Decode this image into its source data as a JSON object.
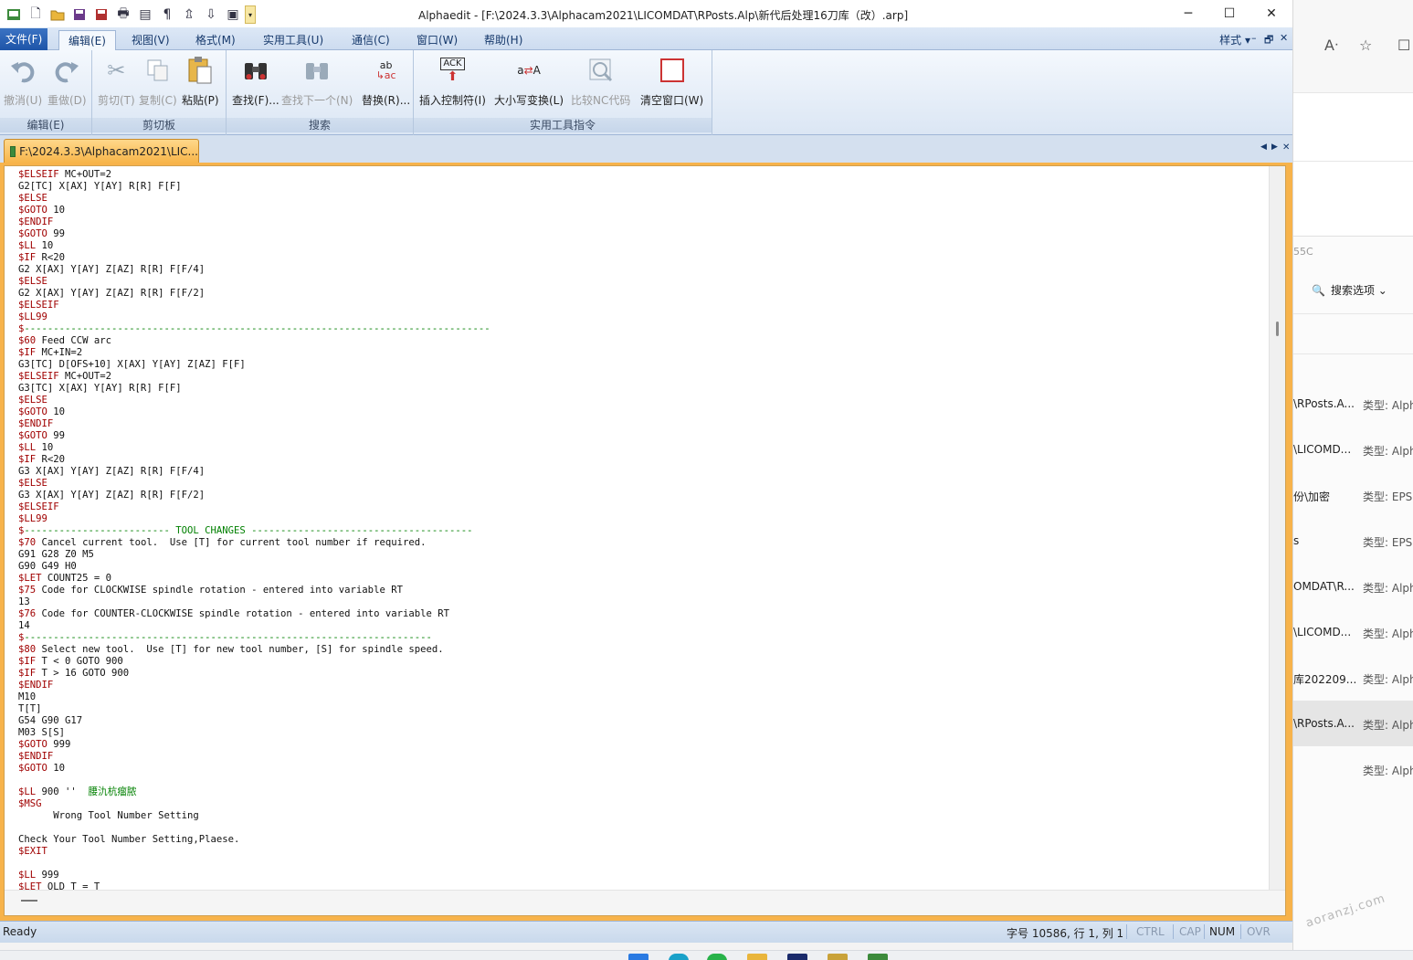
{
  "window": {
    "title": "Alphaedit - [F:\\2024.3.3\\Alphacam2021\\LICOMDAT\\RPosts.Alp\\新代后处理16刀库（改）.arp]",
    "minimize": "─",
    "maximize": "☐",
    "close": "✕"
  },
  "menu": {
    "file": "文件(F)",
    "tabs": [
      "编辑(E)",
      "视图(V)",
      "格式(M)",
      "实用工具(U)",
      "通信(C)",
      "窗口(W)",
      "帮助(H)"
    ],
    "style": "样式",
    "mdi_min": "–",
    "mdi_restore": "🗗",
    "mdi_close": "✕"
  },
  "ribbon": {
    "groups": {
      "edit": "编辑(E)",
      "clipboard": "剪切板",
      "search": "搜索",
      "tools": "实用工具指令"
    },
    "undo": "撤消(U)",
    "redo": "重做(D)",
    "cut": "剪切(T)",
    "copy": "复制(C)",
    "paste": "粘贴(P)",
    "find": "查找(F)...",
    "find_next": "查找下一个(N)",
    "replace": "替换(R)...",
    "insert_ctrl": "插入控制符(I)",
    "case_convert": "大小写变换(L)",
    "compare_nc": "比较NC代码",
    "clear_window": "清空窗口(W)",
    "ack_label": "ACK",
    "replace_glyph_top": "ab",
    "replace_glyph_bottom": "ac",
    "case_glyph_a": "a",
    "case_glyph_A": "A"
  },
  "document_tab": {
    "label": "F:\\2024.3.3\\Alphacam2021\\LIC..."
  },
  "editor": {
    "lines": [
      "$ELSEIF MC+OUT=2",
      "G2[TC] X[AX] Y[AY] R[R] F[F]",
      "$ELSE",
      "$GOTO 10",
      "$ENDIF",
      "$GOTO 99",
      "$LL 10",
      "$IF R<20",
      "G2 X[AX] Y[AY] Z[AZ] R[R] F[F/4]",
      "$ELSE",
      "G2 X[AX] Y[AY] Z[AZ] R[R] F[F/2]",
      "$ELSEIF",
      "$LL99",
      "$--------------------------------------------------------------------------------",
      "$60 Feed CCW arc",
      "$IF MC+IN=2",
      "G3[TC] D[OFS+10] X[AX] Y[AY] Z[AZ] F[F]",
      "$ELSEIF MC+OUT=2",
      "G3[TC] X[AX] Y[AY] R[R] F[F]",
      "$ELSE",
      "$GOTO 10",
      "$ENDIF",
      "$GOTO 99",
      "$LL 10",
      "$IF R<20",
      "G3 X[AX] Y[AY] Z[AZ] R[R] F[F/4]",
      "$ELSE",
      "G3 X[AX] Y[AY] Z[AZ] R[R] F[F/2]",
      "$ELSEIF",
      "$LL99",
      "$------------------------- TOOL CHANGES --------------------------------------",
      "$70 Cancel current tool.  Use [T] for current tool number if required.",
      "G91 G28 Z0 M5",
      "G90 G49 H0",
      "$LET COUNT25 = 0",
      "$75 Code for CLOCKWISE spindle rotation - entered into variable RT",
      "13",
      "$76 Code for COUNTER-CLOCKWISE spindle rotation - entered into variable RT",
      "14",
      "$----------------------------------------------------------------------",
      "$80 Select new tool.  Use [T] for new tool number, [S] for spindle speed.",
      "$IF T < 0 GOTO 900",
      "$IF T > 16 GOTO 900",
      "$ENDIF",
      "M10",
      "T[T]",
      "G54 G90 G17",
      "M03 S[S]",
      "$GOTO 999",
      "$ENDIF",
      "$GOTO 10",
      "",
      "$LL 900 ''  腰氿杭瘤脓",
      "$MSG",
      "      Wrong Tool Number Setting",
      "",
      "Check Your Tool Number Setting,Plaese.",
      "$EXIT",
      "",
      "$LL 999",
      "$LET OLD_T = T"
    ]
  },
  "status": {
    "ready": "Ready",
    "position": "字号 10586, 行 1, 列 1",
    "ctrl": "CTRL",
    "cap": "CAP",
    "num": "NUM",
    "ovr": "OVR"
  },
  "background_window": {
    "code_fragment": "55C",
    "search_options": "搜索选项",
    "results": [
      {
        "name": "\\RPosts.A...",
        "type": "类型: Alph"
      },
      {
        "name": "\\LICOMD...",
        "type": "类型: Alph"
      },
      {
        "name": "份\\加密",
        "type": "类型: EPS"
      },
      {
        "name": "s",
        "type": "类型: EPS"
      },
      {
        "name": "OMDAT\\R...",
        "type": "类型: Alph"
      },
      {
        "name": "\\LICOMD...",
        "type": "类型: Alph"
      },
      {
        "name": "库202209...",
        "type": "类型: Alph"
      },
      {
        "name": "\\RPosts.A...",
        "type": "类型: Alph"
      },
      {
        "name": "",
        "type": "类型: Alph"
      }
    ],
    "watermark": "aoranzj.com"
  },
  "colors": {
    "keyword": "#a00000",
    "comment": "#008000",
    "tab_accent": "#f7b34b",
    "ribbon_blue": "#dbe6f4"
  }
}
